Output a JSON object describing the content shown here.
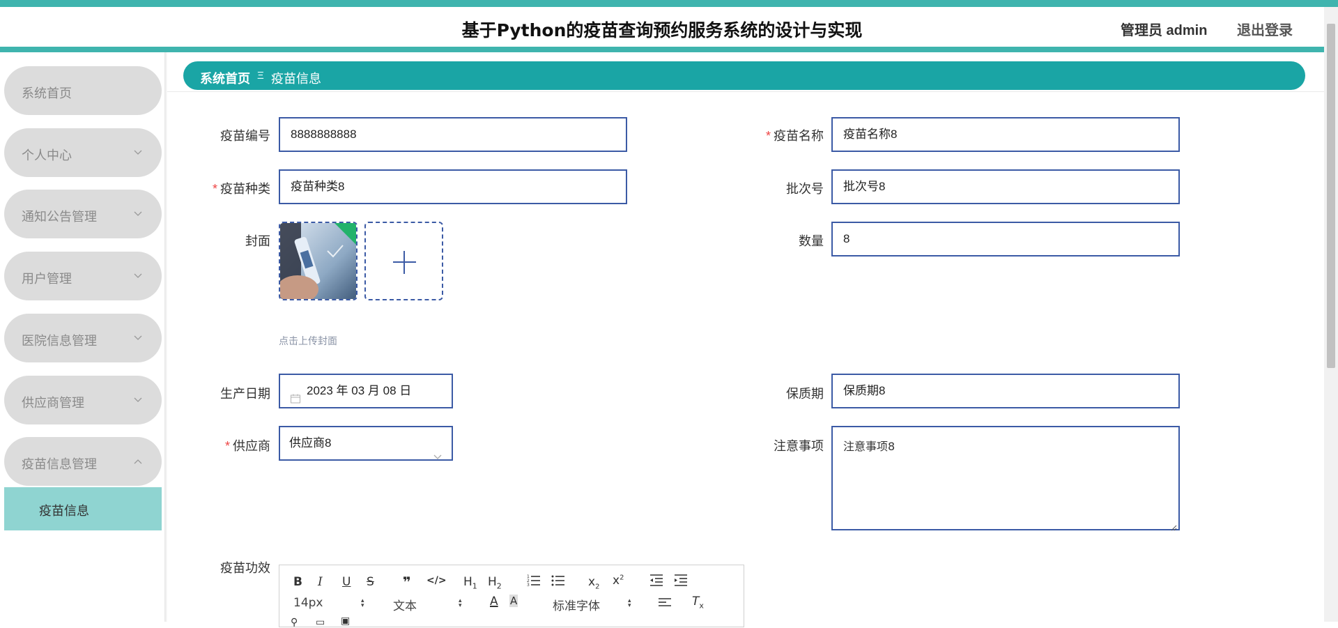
{
  "header": {
    "title": "基于Python的疫苗查询预约服务系统的设计与实现",
    "admin_label": "管理员 admin",
    "logout_label": "退出登录"
  },
  "sidebar": {
    "items": [
      {
        "label": "系统首页"
      },
      {
        "label": "个人中心"
      },
      {
        "label": "通知公告管理"
      },
      {
        "label": "用户管理"
      },
      {
        "label": "医院信息管理"
      },
      {
        "label": "供应商管理"
      },
      {
        "label": "疫苗信息管理"
      }
    ],
    "active_sub": "疫苗信息"
  },
  "breadcrumb": {
    "home": "系统首页",
    "separator": "Ξ",
    "current": "疫苗信息"
  },
  "form": {
    "vaccine_code": {
      "label": "疫苗编号",
      "value": "8888888888"
    },
    "vaccine_name": {
      "label": "疫苗名称",
      "value": "疫苗名称8"
    },
    "vaccine_type": {
      "label": "疫苗种类",
      "value": "疫苗种类8"
    },
    "batch_no": {
      "label": "批次号",
      "value": "批次号8"
    },
    "cover": {
      "label": "封面",
      "hint": "点击上传封面"
    },
    "quantity": {
      "label": "数量",
      "value": "8"
    },
    "production_date": {
      "label": "生产日期",
      "value": "2023 年 03 月 08 日"
    },
    "shelf_life": {
      "label": "保质期",
      "value": "保质期8"
    },
    "supplier": {
      "label": "供应商",
      "value": "供应商8"
    },
    "notes": {
      "label": "注意事项",
      "value": "注意事项8"
    },
    "efficacy": {
      "label": "疫苗功效"
    }
  },
  "editor": {
    "font_size": "14px",
    "text_type": "文本",
    "font_family": "标准字体"
  },
  "colors": {
    "accent": "#1aa5a5",
    "header_strip": "#3fb4ae",
    "input_border": "#3b5aa5",
    "menu_bg": "#dcdcdc",
    "active_sub_bg": "#8fd4d1"
  }
}
